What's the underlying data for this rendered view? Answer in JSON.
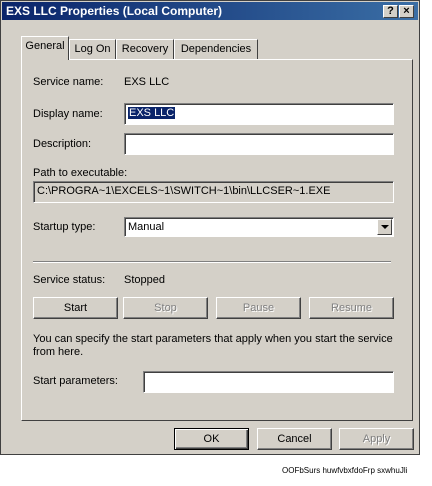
{
  "window": {
    "title": "EXS LLC Properties (Local Computer)",
    "help_label": "?",
    "close_label": "×"
  },
  "tabs": [
    {
      "label": "General",
      "active": true
    },
    {
      "label": "Log On",
      "active": false
    },
    {
      "label": "Recovery",
      "active": false
    },
    {
      "label": "Dependencies",
      "active": false
    }
  ],
  "general": {
    "service_name_label": "Service name:",
    "service_name_value": "EXS LLC",
    "display_name_label": "Display name:",
    "display_name_value": "EXS LLC",
    "description_label": "Description:",
    "description_value": "",
    "path_label": "Path to executable:",
    "path_value": "C:\\PROGRA~1\\EXCELS~1\\SWITCH~1\\bin\\LLCSER~1.EXE",
    "startup_type_label": "Startup type:",
    "startup_type_value": "Manual",
    "service_status_label": "Service status:",
    "service_status_value": "Stopped",
    "start_label": "Start",
    "stop_label": "Stop",
    "pause_label": "Pause",
    "resume_label": "Resume",
    "help_text": "You can specify the start parameters that apply when you start the service from here.",
    "start_params_label": "Start parameters:",
    "start_params_value": ""
  },
  "footer": {
    "ok_label": "OK",
    "cancel_label": "Cancel",
    "apply_label": "Apply"
  },
  "caption": "OOFbSurs huwfvbxfdoFrp sxwhuЈli"
}
